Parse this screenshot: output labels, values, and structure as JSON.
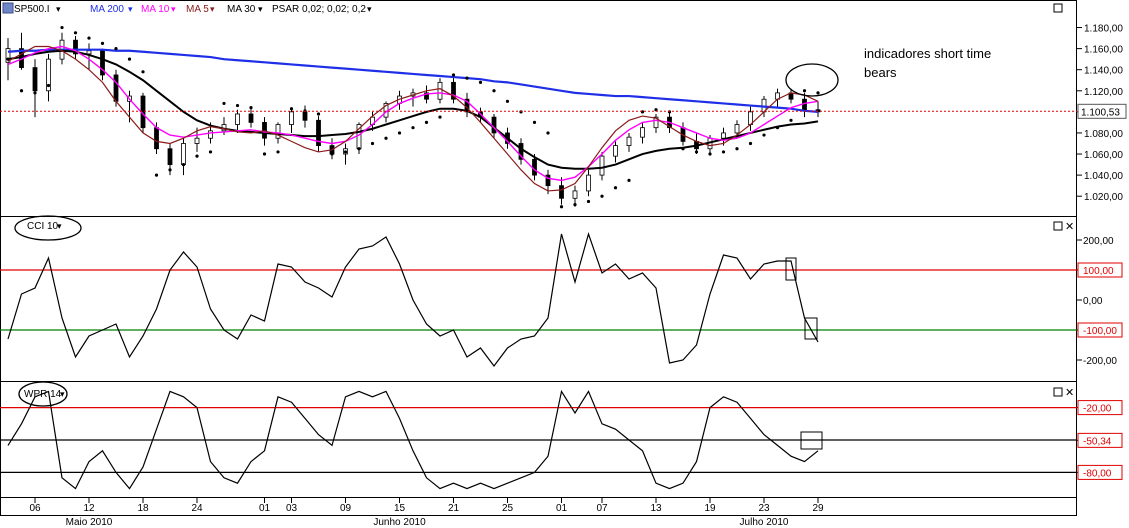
{
  "toolbar": {
    "symbol": "SP500.I",
    "indicators": [
      "MA 200",
      "MA 10",
      "MA 5",
      "MA 30",
      "PSAR 0,02; 0,02; 0,2"
    ]
  },
  "annotation": [
    "indicadores short time",
    "bears"
  ],
  "colors": {
    "ma200": "#1f2fe8",
    "ma10": "#ff00ff",
    "ma5": "#8b1a1a",
    "ma30": "#000000",
    "psar": "#000000",
    "price_line": "#e00000",
    "level_red": "#e00000",
    "level_green": "#008000",
    "level_black": "#000000",
    "up_candle": "#ffffff",
    "down_candle": "#000000"
  },
  "chart_data": [
    {
      "panel": "price",
      "type": "candlestick",
      "symbol": "SP500.I",
      "last_price_label": "1.100,53",
      "last_price": 1100.53,
      "ylim": [
        1005,
        1190
      ],
      "ytick_labels": [
        "1.180,00",
        "1.160,00",
        "1.140,00",
        "1.120,00",
        "1.100,00",
        "1.080,00",
        "1.060,00",
        "1.040,00",
        "1.020,00"
      ],
      "ytick_values": [
        1180,
        1160,
        1140,
        1120,
        1100,
        1080,
        1060,
        1040,
        1020
      ],
      "dates": [
        "05-04",
        "05-05",
        "05-06",
        "05-07",
        "05-10",
        "05-11",
        "05-12",
        "05-13",
        "05-14",
        "05-17",
        "05-18",
        "05-19",
        "05-20",
        "05-21",
        "05-24",
        "05-25",
        "05-26",
        "05-27",
        "05-28",
        "06-01",
        "06-02",
        "06-03",
        "06-04",
        "06-07",
        "06-08",
        "06-09",
        "06-10",
        "06-11",
        "06-14",
        "06-15",
        "06-16",
        "06-17",
        "06-18",
        "06-21",
        "06-22",
        "06-23",
        "06-24",
        "06-25",
        "06-28",
        "06-29",
        "06-30",
        "07-01",
        "07-02",
        "07-06",
        "07-07",
        "07-08",
        "07-09",
        "07-12",
        "07-13",
        "07-14",
        "07-15",
        "07-16",
        "07-19",
        "07-20",
        "07-21",
        "07-22",
        "07-23",
        "07-26",
        "07-27",
        "07-28",
        "07-29"
      ],
      "series": [
        {
          "name": "MA 200",
          "values": [
            1157,
            1158,
            1158,
            1159,
            1159,
            1159,
            1159,
            1159,
            1158,
            1158,
            1157,
            1156,
            1155,
            1154,
            1153,
            1152,
            1150,
            1149,
            1148,
            1147,
            1146,
            1145,
            1144,
            1143,
            1142,
            1141,
            1140,
            1139,
            1138,
            1137,
            1136,
            1135,
            1134,
            1133,
            1132,
            1131,
            1129,
            1128,
            1126,
            1124,
            1122,
            1120,
            1118,
            1117,
            1116,
            1115,
            1115,
            1114,
            1113,
            1112,
            1111,
            1110,
            1109,
            1108,
            1107,
            1106,
            1105,
            1104,
            1103,
            1101,
            1100
          ]
        },
        {
          "name": "MA 30",
          "values": [
            1150,
            1152,
            1155,
            1157,
            1158,
            1157,
            1154,
            1150,
            1145,
            1138,
            1130,
            1120,
            1110,
            1100,
            1092,
            1087,
            1084,
            1082,
            1081,
            1080,
            1079,
            1078,
            1077,
            1077,
            1078,
            1079,
            1081,
            1084,
            1088,
            1092,
            1096,
            1100,
            1103,
            1103,
            1101,
            1095,
            1085,
            1075,
            1065,
            1057,
            1050,
            1047,
            1046,
            1046,
            1047,
            1050,
            1055,
            1060,
            1063,
            1065,
            1066,
            1068,
            1071,
            1074,
            1077,
            1080,
            1083,
            1086,
            1088,
            1089,
            1091
          ]
        },
        {
          "name": "MA 10",
          "values": [
            1145,
            1150,
            1156,
            1160,
            1162,
            1158,
            1150,
            1140,
            1128,
            1112,
            1098,
            1085,
            1078,
            1076,
            1078,
            1080,
            1081,
            1082,
            1083,
            1081,
            1080,
            1078,
            1075,
            1072,
            1070,
            1072,
            1078,
            1088,
            1100,
            1108,
            1113,
            1117,
            1118,
            1116,
            1110,
            1098,
            1085,
            1072,
            1058,
            1045,
            1037,
            1035,
            1038,
            1048,
            1060,
            1073,
            1083,
            1090,
            1092,
            1090,
            1085,
            1080,
            1075,
            1073,
            1075,
            1080,
            1088,
            1096,
            1104,
            1108,
            1110
          ]
        },
        {
          "name": "MA 5",
          "values": [
            1148,
            1155,
            1162,
            1162,
            1158,
            1150,
            1140,
            1128,
            1110,
            1095,
            1080,
            1072,
            1070,
            1075,
            1082,
            1086,
            1084,
            1081,
            1080,
            1082,
            1078,
            1072,
            1066,
            1062,
            1064,
            1072,
            1084,
            1096,
            1106,
            1112,
            1116,
            1120,
            1122,
            1115,
            1104,
            1090,
            1075,
            1060,
            1045,
            1032,
            1025,
            1026,
            1032,
            1048,
            1066,
            1082,
            1092,
            1096,
            1094,
            1086,
            1078,
            1072,
            1068,
            1070,
            1078,
            1088,
            1100,
            1112,
            1118,
            1116,
            1110
          ]
        },
        {
          "name": "PSAR",
          "values": [
            1150,
            1120,
            1118,
            1125,
            1180,
            1175,
            1170,
            1165,
            1160,
            1150,
            1138,
            1040,
            1045,
            1050,
            1058,
            1062,
            1108,
            1106,
            1104,
            1060,
            1062,
            1103,
            1101,
            1098,
            1060,
            1062,
            1065,
            1070,
            1075,
            1080,
            1085,
            1090,
            1095,
            1135,
            1132,
            1128,
            1120,
            1110,
            1100,
            1090,
            1080,
            1010,
            1012,
            1015,
            1020,
            1028,
            1035,
            1100,
            1102,
            1100,
            1065,
            1062,
            1060,
            1062,
            1065,
            1070,
            1078,
            1085,
            1092,
            1120,
            1118
          ]
        }
      ],
      "ohlc": [
        [
          1147,
          1170,
          1130,
          1160
        ],
        [
          1160,
          1175,
          1140,
          1142
        ],
        [
          1142,
          1150,
          1095,
          1120
        ],
        [
          1120,
          1155,
          1110,
          1150
        ],
        [
          1150,
          1175,
          1145,
          1168
        ],
        [
          1168,
          1172,
          1150,
          1155
        ],
        [
          1155,
          1165,
          1140,
          1158
        ],
        [
          1158,
          1160,
          1130,
          1135
        ],
        [
          1135,
          1140,
          1105,
          1110
        ],
        [
          1110,
          1120,
          1090,
          1115
        ],
        [
          1115,
          1118,
          1080,
          1085
        ],
        [
          1085,
          1090,
          1060,
          1065
        ],
        [
          1065,
          1070,
          1040,
          1050
        ],
        [
          1050,
          1075,
          1040,
          1070
        ],
        [
          1070,
          1085,
          1062,
          1075
        ],
        [
          1075,
          1090,
          1070,
          1082
        ],
        [
          1082,
          1095,
          1078,
          1088
        ],
        [
          1088,
          1102,
          1080,
          1098
        ],
        [
          1098,
          1104,
          1085,
          1090
        ],
        [
          1090,
          1095,
          1068,
          1075
        ],
        [
          1075,
          1090,
          1070,
          1088
        ],
        [
          1088,
          1102,
          1080,
          1100
        ],
        [
          1100,
          1106,
          1085,
          1092
        ],
        [
          1092,
          1096,
          1062,
          1068
        ],
        [
          1068,
          1075,
          1055,
          1060
        ],
        [
          1060,
          1070,
          1050,
          1065
        ],
        [
          1065,
          1090,
          1060,
          1088
        ],
        [
          1088,
          1100,
          1082,
          1095
        ],
        [
          1095,
          1110,
          1090,
          1108
        ],
        [
          1108,
          1120,
          1102,
          1115
        ],
        [
          1115,
          1122,
          1105,
          1118
        ],
        [
          1118,
          1125,
          1108,
          1112
        ],
        [
          1112,
          1132,
          1108,
          1128
        ],
        [
          1128,
          1132,
          1108,
          1112
        ],
        [
          1112,
          1118,
          1095,
          1100
        ],
        [
          1100,
          1104,
          1090,
          1095
        ],
        [
          1095,
          1098,
          1075,
          1080
        ],
        [
          1080,
          1085,
          1065,
          1070
        ],
        [
          1070,
          1075,
          1050,
          1055
        ],
        [
          1055,
          1060,
          1035,
          1040
        ],
        [
          1040,
          1045,
          1022,
          1030
        ],
        [
          1030,
          1038,
          1012,
          1018
        ],
        [
          1018,
          1030,
          1010,
          1025
        ],
        [
          1025,
          1045,
          1020,
          1040
        ],
        [
          1040,
          1062,
          1035,
          1058
        ],
        [
          1058,
          1072,
          1052,
          1068
        ],
        [
          1068,
          1080,
          1062,
          1076
        ],
        [
          1076,
          1090,
          1070,
          1085
        ],
        [
          1085,
          1098,
          1080,
          1095
        ],
        [
          1095,
          1100,
          1080,
          1085
        ],
        [
          1085,
          1090,
          1068,
          1072
        ],
        [
          1072,
          1080,
          1060,
          1065
        ],
        [
          1065,
          1078,
          1060,
          1075
        ],
        [
          1075,
          1085,
          1068,
          1080
        ],
        [
          1080,
          1092,
          1075,
          1088
        ],
        [
          1088,
          1105,
          1082,
          1100
        ],
        [
          1100,
          1115,
          1095,
          1112
        ],
        [
          1112,
          1122,
          1105,
          1118
        ],
        [
          1118,
          1122,
          1108,
          1112
        ],
        [
          1112,
          1118,
          1095,
          1102
        ],
        [
          1102,
          1110,
          1095,
          1100
        ]
      ]
    },
    {
      "panel": "cci",
      "type": "line",
      "title": "CCI 10",
      "ylim": [
        -260,
        260
      ],
      "ytick_labels": [
        "200,00",
        "100,00",
        "0,00",
        "-100,00",
        "-200,00"
      ],
      "ytick_values": [
        200,
        100,
        0,
        -100,
        -200
      ],
      "levels": [
        {
          "value": 100,
          "label": "100,00",
          "color": "red"
        },
        {
          "value": -100,
          "label": "-100,00",
          "color": "green"
        }
      ],
      "values": [
        -130,
        20,
        40,
        140,
        -60,
        -190,
        -120,
        -100,
        -80,
        -190,
        -120,
        -30,
        100,
        160,
        110,
        -30,
        -100,
        -130,
        -50,
        -70,
        120,
        110,
        60,
        40,
        10,
        110,
        170,
        180,
        210,
        120,
        0,
        -80,
        -120,
        -100,
        -190,
        -160,
        -220,
        -160,
        -130,
        -120,
        -60,
        220,
        60,
        220,
        90,
        120,
        70,
        90,
        40,
        -210,
        -200,
        -150,
        20,
        150,
        140,
        70,
        120,
        130,
        130,
        -60,
        -140
      ]
    },
    {
      "panel": "wpr",
      "type": "line",
      "title": "WPR 14",
      "ylim": [
        -100,
        0
      ],
      "ytick_labels": [
        "-20,00",
        "-50,34",
        "-80,00"
      ],
      "ytick_values": [
        -20,
        -50.34,
        -80
      ],
      "levels": [
        {
          "value": -20,
          "label": "-20,00",
          "color": "red"
        },
        {
          "value": -50,
          "label": "",
          "color": "black"
        },
        {
          "value": -80,
          "label": "-80,00",
          "color": "black"
        }
      ],
      "values": [
        -55,
        -35,
        -10,
        -5,
        -85,
        -95,
        -70,
        -60,
        -80,
        -95,
        -75,
        -40,
        -5,
        -10,
        -20,
        -70,
        -85,
        -90,
        -70,
        -60,
        -10,
        -15,
        -30,
        -45,
        -55,
        -10,
        -5,
        -10,
        -5,
        -30,
        -60,
        -85,
        -95,
        -90,
        -95,
        -90,
        -95,
        -90,
        -85,
        -80,
        -65,
        -5,
        -25,
        -5,
        -35,
        -40,
        -50,
        -60,
        -90,
        -95,
        -90,
        -70,
        -20,
        -10,
        -15,
        -30,
        -45,
        -55,
        -65,
        -70,
        -60
      ]
    }
  ],
  "xaxis": {
    "day_labels": [
      "06",
      "12",
      "18",
      "24",
      "01",
      "03",
      "09",
      "15",
      "21",
      "25",
      "01",
      "07",
      "13",
      "19",
      "23",
      "29"
    ],
    "day_dates": [
      "05-06",
      "05-12",
      "05-18",
      "05-24",
      "06-01",
      "06-03",
      "06-09",
      "06-15",
      "06-21",
      "06-25",
      "07-01",
      "07-07",
      "07-13",
      "07-19",
      "07-23",
      "07-29"
    ],
    "month_labels": [
      "Maio 2010",
      "Junho 2010",
      "Julho 2010"
    ],
    "month_dates": [
      "05-12",
      "06-15",
      "07-23"
    ]
  }
}
